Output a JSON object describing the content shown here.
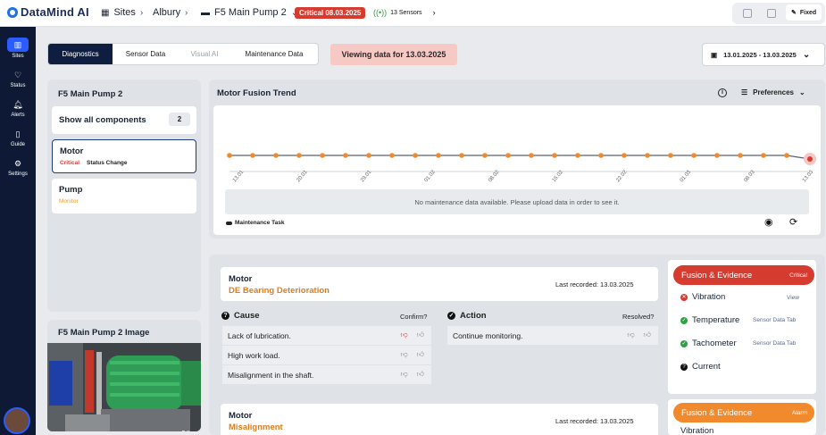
{
  "topbar": {
    "logo": "DataMind AI",
    "breadcrumbs": [
      "Sites",
      "Albury",
      "F5 Main Pump 2"
    ],
    "critical_badge": "Critical 08.03.2025",
    "sensors": "13 Sensors",
    "fixed_label": "Fixed"
  },
  "sidebar": {
    "items": [
      {
        "label": "Sites",
        "icon": "chart-icon"
      },
      {
        "label": "Status",
        "icon": "heart-icon"
      },
      {
        "label": "Alerts",
        "icon": "bell-icon"
      },
      {
        "label": "Guide",
        "icon": "document-icon"
      },
      {
        "label": "Settings",
        "icon": "gear-icon"
      }
    ]
  },
  "tabs": [
    "Diagnostics",
    "Sensor Data",
    "Visual AI",
    "Maintenance Data"
  ],
  "viewing": "Viewing data for 13.03.2025",
  "date_range": "13.01.2025 - 13.03.2025",
  "left_panel": {
    "title": "F5 Main Pump 2",
    "show_all": "Show all components",
    "count": "2",
    "components": [
      {
        "name": "Motor",
        "status": "Critical",
        "extra": "Status Change"
      },
      {
        "name": "Pump",
        "status": "Monitor",
        "extra": ""
      }
    ]
  },
  "image_panel": {
    "title": "F5 Main Pump 2 Image"
  },
  "trend": {
    "title": "Motor Fusion Trend",
    "preferences": "Preferences",
    "no_data": "No maintenance data available. Please upload data in order to see it.",
    "legend": "Maintenance Task"
  },
  "chart_data": {
    "type": "line",
    "title": "Motor Fusion Trend",
    "x": [
      "13.01",
      "20.01",
      "29.01",
      "01.02",
      "08.02",
      "15.02",
      "22.02",
      "01.03",
      "08.03",
      "13.03"
    ],
    "tick_labels": [
      "13.01",
      "20.01",
      "29.01",
      "01.02",
      "08.02",
      "15.02",
      "22.02",
      "01.03",
      "08.03",
      "13.03"
    ],
    "series": [
      {
        "values": [
          1,
          1,
          1,
          1,
          1,
          1,
          1,
          1,
          1,
          1,
          1,
          1,
          1,
          1,
          1,
          1,
          1,
          1,
          1,
          1,
          1,
          1,
          1,
          1,
          1,
          0.6
        ]
      }
    ],
    "point_colors": {
      "normal": "#f08a2d",
      "last": "#d63b30"
    },
    "grid": false
  },
  "findings": [
    {
      "component": "Motor",
      "fault": "DE Bearing Deterioration",
      "last_recorded": "Last recorded: 13.03.2025",
      "cause_title": "Cause",
      "cause_question": "Confirm?",
      "causes": [
        "Lack of lubrication.",
        "High work load.",
        "Misalignment in the shaft."
      ],
      "action_title": "Action",
      "action_question": "Resolved?",
      "actions": [
        "Continue monitoring."
      ]
    },
    {
      "component": "Motor",
      "fault": "Misalignment",
      "last_recorded": "Last recorded: 13.03.2025"
    }
  ],
  "evidence": [
    {
      "title": "Fusion & Evidence",
      "level": "Critical",
      "color": "#d63b30",
      "items": [
        {
          "label": "Vibration",
          "status": "critical",
          "link": "View"
        },
        {
          "label": "Temperature",
          "status": "ok",
          "link": "Sensor Data Tab"
        },
        {
          "label": "Tachometer",
          "status": "ok",
          "link": "Sensor Data Tab"
        },
        {
          "label": "Current",
          "status": "info",
          "link": ""
        }
      ]
    },
    {
      "title": "Fusion & Evidence",
      "level": "Alarm",
      "color": "#f08a2d",
      "items": [
        {
          "label": "Vibration",
          "status": "",
          "link": ""
        }
      ]
    }
  ]
}
